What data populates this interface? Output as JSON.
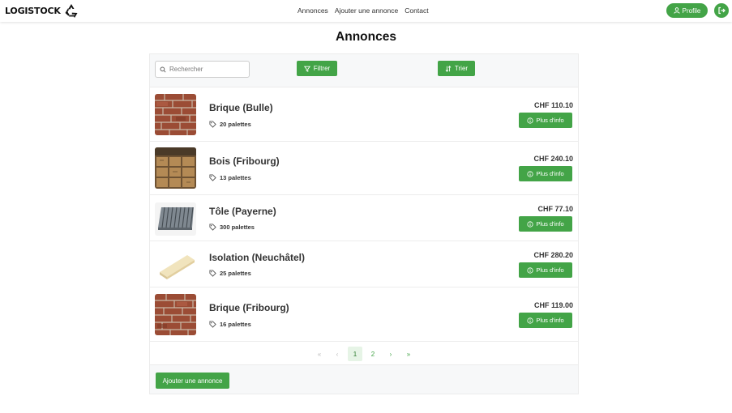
{
  "app": {
    "brand": "LOGISTOCK"
  },
  "nav": {
    "links": [
      "Annonces",
      "Ajouter une annonce",
      "Contact"
    ],
    "profile_label": "Profile"
  },
  "page": {
    "title": "Annonces"
  },
  "toolbar": {
    "search_placeholder": "Rechercher",
    "filter_label": "Filtrer",
    "sort_label": "Trier"
  },
  "listings": [
    {
      "title": "Brique (Bulle)",
      "qty": "20 palettes",
      "price": "CHF 110.10",
      "info_label": "Plus d'info",
      "image": "brick"
    },
    {
      "title": "Bois (Fribourg)",
      "qty": "13 palettes",
      "price": "CHF 240.10",
      "info_label": "Plus d'info",
      "image": "wood"
    },
    {
      "title": "Tôle (Payerne)",
      "qty": "300 palettes",
      "price": "CHF 77.10",
      "info_label": "Plus d'info",
      "image": "sheet-metal"
    },
    {
      "title": "Isolation (Neuchâtel)",
      "qty": "25 palettes",
      "price": "CHF 280.20",
      "info_label": "Plus d'info",
      "image": "insulation"
    },
    {
      "title": "Brique (Fribourg)",
      "qty": "16 palettes",
      "price": "CHF 119.00",
      "info_label": "Plus d'info",
      "image": "brick"
    }
  ],
  "pagination": {
    "first": "«",
    "prev": "‹",
    "pages": [
      "1",
      "2"
    ],
    "current": "1",
    "next": "›",
    "last": "»"
  },
  "footer": {
    "add_label": "Ajouter une annonce"
  },
  "colors": {
    "accent": "#43a447"
  }
}
